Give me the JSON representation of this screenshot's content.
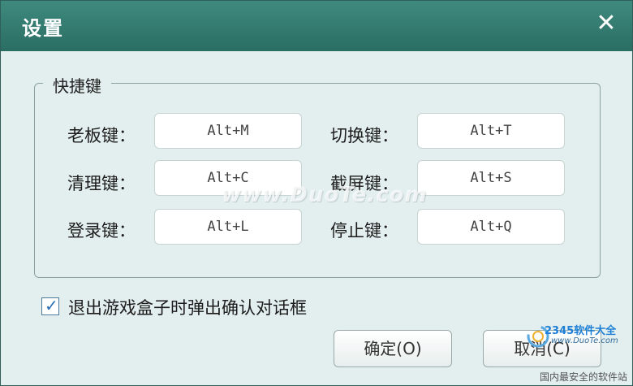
{
  "window": {
    "title": "设置",
    "close_icon": "close-icon"
  },
  "group": {
    "legend": "快捷键",
    "hotkeys": [
      {
        "label": "老板键：",
        "value": "Alt+M"
      },
      {
        "label": "切换键：",
        "value": "Alt+T"
      },
      {
        "label": "清理键：",
        "value": "Alt+C"
      },
      {
        "label": "截屏键：",
        "value": "Alt+S"
      },
      {
        "label": "登录键：",
        "value": "Alt+L"
      },
      {
        "label": "停止键：",
        "value": "Alt+Q"
      }
    ]
  },
  "confirm_exit": {
    "checked": true,
    "label": "退出游戏盒子时弹出确认对话框"
  },
  "buttons": {
    "ok": "确定(O)",
    "cancel": "取消(C)"
  },
  "watermark": {
    "text": "www.DuoTe.com",
    "logo_text": "2345软件大全",
    "logo_site": "www.DuoTe.com",
    "bottom_tag": "国内最安全的软件站"
  },
  "colors": {
    "titlebar": "#2f7a6f",
    "background": "#e3efee",
    "accent": "#2a6fb0"
  }
}
